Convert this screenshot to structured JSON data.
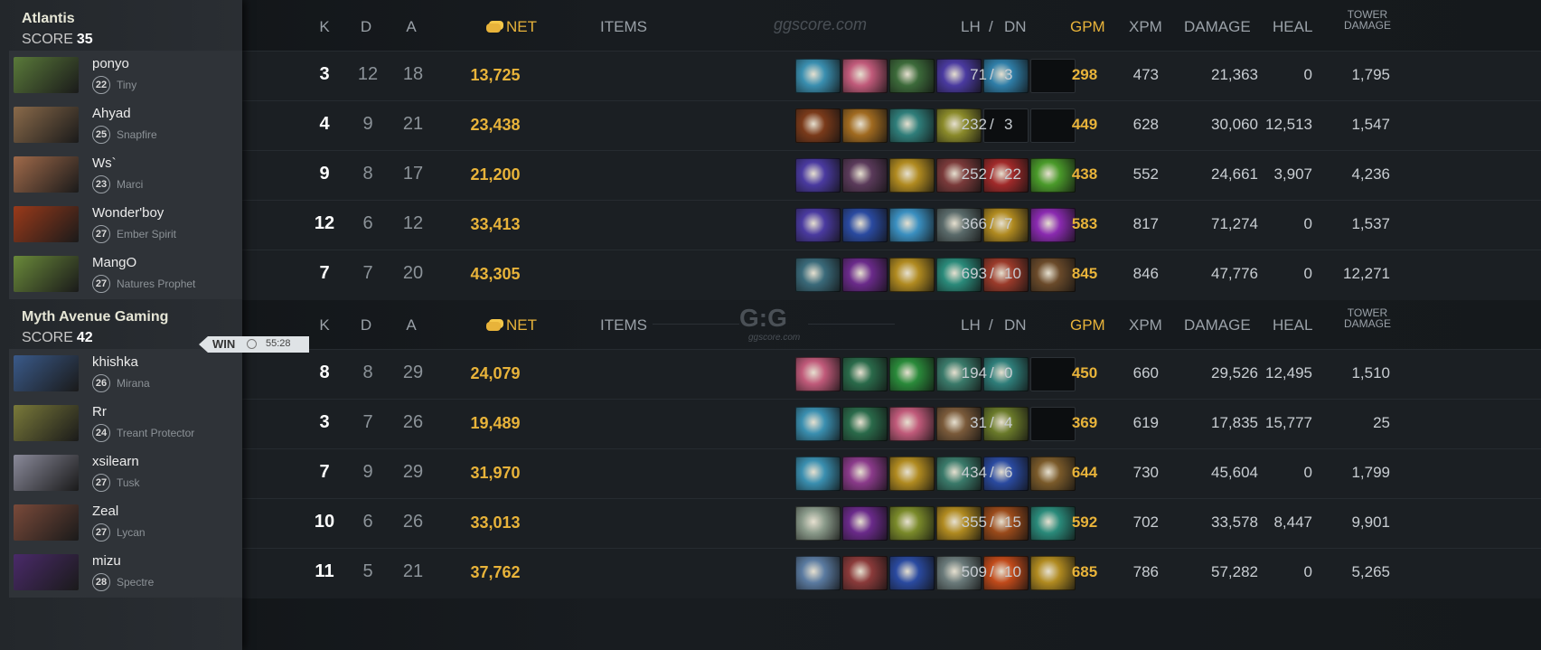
{
  "headers": {
    "k": "K",
    "d": "D",
    "a": "A",
    "net": "NET",
    "items": "ITEMS",
    "lh": "LH",
    "slash": "/",
    "dn": "DN",
    "gpm": "GPM",
    "xpm": "XPM",
    "damage": "DAMAGE",
    "heal": "HEAL",
    "tower_1": "TOWER",
    "tower_2": "DAMAGE"
  },
  "watermark_1": "ggscore.com",
  "watermark_2_logo": "G:G",
  "watermark_2_sub": "ggscore.com",
  "result": {
    "label": "WIN",
    "time": "55:28",
    "clock_icon": "clock-icon"
  },
  "teams": [
    {
      "name": "Atlantis",
      "score_label": "SCORE",
      "score": "35",
      "players": [
        {
          "name": "ponyo",
          "level": "22",
          "hero": "Tiny",
          "portrait_color": "#5a7a3a",
          "k": "3",
          "d": "12",
          "a": "18",
          "net": "13,725",
          "lh": "71",
          "dn": "3",
          "gpm": "298",
          "xpm": "473",
          "damage": "21,363",
          "heal": "0",
          "tower": "1,795",
          "items": [
            "#3a8fb0",
            "#c05a7a",
            "#3c6a3a",
            "#4a3aa0",
            "#2f7ea8",
            null
          ]
        },
        {
          "name": "Ahyad",
          "level": "25",
          "hero": "Snapfire",
          "portrait_color": "#8a6a4a",
          "k": "4",
          "d": "9",
          "a": "21",
          "net": "23,438",
          "lh": "232",
          "dn": "3",
          "gpm": "449",
          "xpm": "628",
          "damage": "30,060",
          "heal": "12,513",
          "tower": "1,547",
          "items": [
            "#7a3a1a",
            "#a06a20",
            "#2f7e7a",
            "#8a8a2a",
            null,
            null
          ]
        },
        {
          "name": "Ws`",
          "level": "23",
          "hero": "Marci",
          "portrait_color": "#a06a4a",
          "k": "9",
          "d": "8",
          "a": "17",
          "net": "21,200",
          "lh": "252",
          "dn": "22",
          "gpm": "438",
          "xpm": "552",
          "damage": "24,661",
          "heal": "3,907",
          "tower": "4,236",
          "items": [
            "#4a3aa0",
            "#5a3a5a",
            "#b08a20",
            "#7a3a3a",
            "#a02a2a",
            "#4a9a2a"
          ]
        },
        {
          "name": "Wonder'boy",
          "level": "27",
          "hero": "Ember Spirit",
          "portrait_color": "#9a3a1a",
          "k": "12",
          "d": "6",
          "a": "12",
          "net": "33,413",
          "lh": "366",
          "dn": "7",
          "gpm": "583",
          "xpm": "817",
          "damage": "71,274",
          "heal": "0",
          "tower": "1,537",
          "items": [
            "#4a3aa0",
            "#2a4aa0",
            "#3a8fc0",
            "#5a6a6a",
            "#b08a20",
            "#8a2ab0"
          ]
        },
        {
          "name": "MangO",
          "level": "27",
          "hero": "Natures Prophet",
          "portrait_color": "#6a8a3a",
          "k": "7",
          "d": "7",
          "a": "20",
          "net": "43,305",
          "lh": "693",
          "dn": "10",
          "gpm": "845",
          "xpm": "846",
          "damage": "47,776",
          "heal": "0",
          "tower": "12,271",
          "items": [
            "#3a6a7a",
            "#6a2a8a",
            "#b08a20",
            "#2a8a7a",
            "#9a3a2a",
            "#6a4a2a"
          ]
        }
      ]
    },
    {
      "name": "Myth Avenue Gaming",
      "score_label": "SCORE",
      "score": "42",
      "players": [
        {
          "name": "khishka",
          "level": "26",
          "hero": "Mirana",
          "portrait_color": "#3a5a8a",
          "k": "8",
          "d": "8",
          "a": "29",
          "net": "24,079",
          "lh": "194",
          "dn": "0",
          "gpm": "450",
          "xpm": "660",
          "damage": "29,526",
          "heal": "12,495",
          "tower": "1,510",
          "items": [
            "#c05a7a",
            "#2a6a4a",
            "#2a8a3a",
            "#3a7a6a",
            "#2f7e7a",
            null
          ]
        },
        {
          "name": "Rr",
          "level": "24",
          "hero": "Treant Protector",
          "portrait_color": "#7a7a3a",
          "k": "3",
          "d": "7",
          "a": "26",
          "net": "19,489",
          "lh": "31",
          "dn": "4",
          "gpm": "369",
          "xpm": "619",
          "damage": "17,835",
          "heal": "15,777",
          "tower": "25",
          "items": [
            "#3a8fb0",
            "#2a6a4a",
            "#c05a7a",
            "#7a5a3a",
            "#6a7a2a",
            null
          ]
        },
        {
          "name": "xsilearn",
          "level": "27",
          "hero": "Tusk",
          "portrait_color": "#8a8a9a",
          "k": "7",
          "d": "9",
          "a": "29",
          "net": "31,970",
          "lh": "434",
          "dn": "6",
          "gpm": "644",
          "xpm": "730",
          "damage": "45,604",
          "heal": "0",
          "tower": "1,799",
          "items": [
            "#3a8fb0",
            "#8a3a8a",
            "#b08a20",
            "#3a7a6a",
            "#2a4aa0",
            "#7a5a2a"
          ]
        },
        {
          "name": "Zeal",
          "level": "27",
          "hero": "Lycan",
          "portrait_color": "#7a4a3a",
          "k": "10",
          "d": "6",
          "a": "26",
          "net": "33,013",
          "lh": "355",
          "dn": "15",
          "gpm": "592",
          "xpm": "702",
          "damage": "33,578",
          "heal": "8,447",
          "tower": "9,901",
          "items": [
            "#8a9a8a",
            "#6a2a8a",
            "#7a8a2a",
            "#b08a20",
            "#9a4a1a",
            "#2a8a7a"
          ]
        },
        {
          "name": "mizu",
          "level": "28",
          "hero": "Spectre",
          "portrait_color": "#4a2a6a",
          "k": "11",
          "d": "5",
          "a": "21",
          "net": "37,762",
          "lh": "509",
          "dn": "10",
          "gpm": "685",
          "xpm": "786",
          "damage": "57,282",
          "heal": "0",
          "tower": "5,265",
          "items": [
            "#5a7aa0",
            "#8a3a3a",
            "#2a4aa0",
            "#6a7a7a",
            "#c04a1a",
            "#b08a20"
          ]
        }
      ]
    }
  ]
}
